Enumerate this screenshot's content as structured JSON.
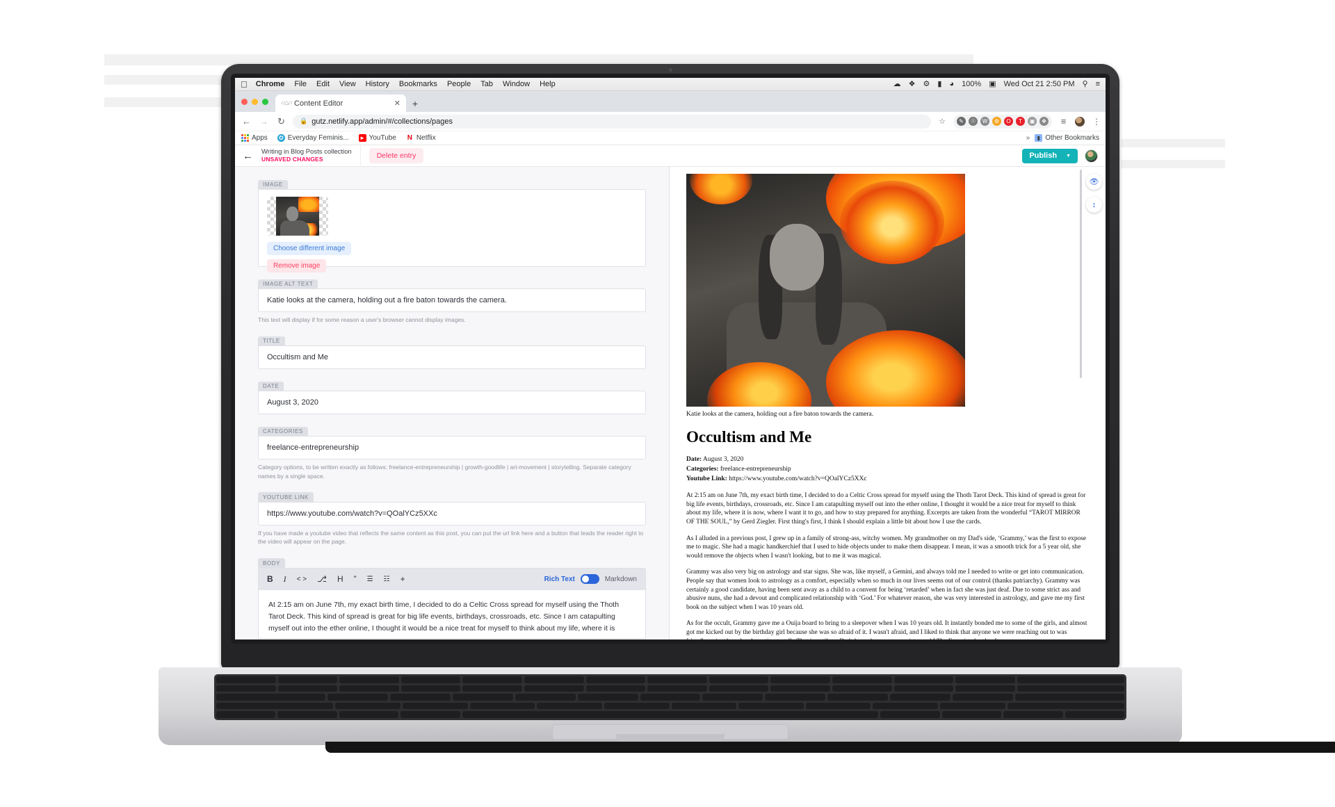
{
  "macos_menubar": {
    "apple_icon": "apple-logo",
    "items": [
      "Chrome",
      "File",
      "Edit",
      "View",
      "History",
      "Bookmarks",
      "People",
      "Tab",
      "Window",
      "Help"
    ],
    "status_icons": [
      "cloud-icon",
      "dropbox-icon",
      "vpn-icon",
      "battery-icon",
      "wifi-icon"
    ],
    "battery_percent": "100%",
    "clock": "Wed Oct 21  2:50 PM",
    "search_icon": "search-icon",
    "control_center_icon": "list-icon"
  },
  "browser": {
    "tab": {
      "title": "Content Editor",
      "favicon": "netlify-cms-favicon",
      "close_icon": "close-icon"
    },
    "new_tab_icon": "plus-icon",
    "nav": {
      "back_icon": "back-arrow-icon",
      "forward_icon": "forward-arrow-icon",
      "reload_icon": "reload-icon"
    },
    "omnibox": {
      "lock_icon": "lock-icon",
      "url": "gutz.netlify.app/admin/#/collections/pages"
    },
    "star_icon": "bookmark-star-icon",
    "extensions": [
      "eyedropper-icon",
      "shield-icon",
      "wordpress-icon",
      "gear-icon",
      "opera-icon",
      "toolbar-icon",
      "grammarly-icon",
      "puzzle-icon"
    ],
    "reading_list_icon": "reading-list-icon",
    "profile_icon": "profile-avatar",
    "menu_icon": "kebab-menu-icon",
    "bookmarks": [
      {
        "label": "Apps",
        "icon": "apps-grid-icon"
      },
      {
        "label": "Everyday Feminis...",
        "icon": "everyday-feminism-icon"
      },
      {
        "label": "YouTube",
        "icon": "youtube-icon"
      },
      {
        "label": "Netflix",
        "icon": "netflix-icon"
      }
    ],
    "bookmarks_overflow": "»",
    "other_bookmarks": "Other Bookmarks",
    "other_bookmarks_icon": "folder-icon"
  },
  "cms_header": {
    "back_icon": "back-arrow-icon",
    "collection_text": "Writing in Blog Posts collection",
    "status_text": "UNSAVED CHANGES",
    "delete_label": "Delete entry",
    "publish_label": "Publish",
    "publish_caret": "▼",
    "avatar": "user-avatar",
    "accent_publish": "#13b3b8",
    "accent_unsaved": "#ff0a5f",
    "accent_delete": "#ff3366"
  },
  "editor": {
    "image": {
      "label": "IMAGE",
      "choose_label": "Choose different image",
      "remove_label": "Remove image"
    },
    "alt": {
      "label": "IMAGE ALT TEXT",
      "value": "Katie looks at the camera, holding out a fire baton towards the camera.",
      "hint": "This text will display if for some reason a user's browser cannot display images."
    },
    "title": {
      "label": "TITLE",
      "value": "Occultism and Me"
    },
    "date": {
      "label": "DATE",
      "value": "August 3, 2020"
    },
    "categories": {
      "label": "CATEGORIES",
      "value": "freelance-entrepreneurship",
      "hint": "Category options, to be written exactly as follows: freelance-entrepreneurship | growth-goodlife | art-movement | storytelling. Separate category names by a single space."
    },
    "youtube": {
      "label": "YOUTUBE LINK",
      "value": "https://www.youtube.com/watch?v=QOalYCz5XXc",
      "hint": "If you have made a youtube video that reflects the same content as this post, you can put the url link here and a button that leads the reader right to the video will appear on the page."
    },
    "body": {
      "label": "BODY",
      "toolbar_icons": [
        "bold-icon",
        "italic-icon",
        "code-icon",
        "link-icon",
        "heading-icon",
        "quote-icon",
        "bullet-list-icon",
        "numbered-list-icon",
        "add-component-icon"
      ],
      "toolbar_glyphs": [
        "B",
        "I",
        "< >",
        "⎇",
        "H",
        "”",
        "☰",
        "☷",
        "+"
      ],
      "rich_text_label": "Rich Text",
      "markdown_label": "Markdown",
      "mode": "Markdown",
      "text": "At 2:15 am on June 7th, my exact birth time, I decided to do a Celtic Cross spread for myself using the Thoth Tarot Deck. This kind of spread is great for big life events, birthdays, crossroads, etc. Since I am catapulting myself out into the ether online, I thought it would be a nice treat for myself to think about my life, where it is"
    }
  },
  "preview": {
    "caption": "Katie looks at the camera, holding out a fire baton towards the camera.",
    "heading": "Occultism and Me",
    "meta": [
      {
        "key": "Date:",
        "value": " August 3, 2020"
      },
      {
        "key": "Categories:",
        "value": " freelance-entrepreneurship"
      },
      {
        "key": "Youtube Link:",
        "value": " https://www.youtube.com/watch?v=QOalYCz5XXc"
      }
    ],
    "paragraphs": [
      "At 2:15 am on June 7th, my exact birth time, I decided to do a Celtic Cross spread for myself using the Thoth Tarot Deck. This kind of spread is great for big life events, birthdays, crossroads, etc. Since I am catapulting myself out into the ether online, I thought it would be a nice treat for myself to think about my life, where it is now, where I want it to go, and how to stay prepared for anything. Excerpts are taken from the wonderful “TAROT MIRROR OF THE SOUL,” by Gerd Ziegler. First thing's first, I think I should explain a little bit about how I use the cards.",
      "As I alluded in a previous post, I grew up in a family of strong-ass, witchy women. My grandmother on my Dad's side, ‘Grammy,’ was the first to expose me to magic. She had a magic handkerchief that I used to hide objects under to make them disappear. I mean, it was a smooth trick for a 5 year old, she would remove the objects when I wasn't looking, but to me it was magical.",
      "Grammy was also very big on astrology and star signs. She was, like myself, a Gemini, and always told me I needed to write or get into communication. People say that women look to astrology as a comfort, especially when so much in our lives seems out of our control (thanks patriarchy). Grammy was certainly a good candidate, having been sent away as a child to a convent for being ‘retarded’ when in fact she was just deaf. Due to some strict ass and abusive nuns, she had a devout and complicated relationship with ‘God.’ For whatever reason, she was very interested in astrology, and gave me my first book on the subject when I was 10 years old.",
      "As for the occult, Grammy gave me a Ouija board to bring to a sleepover when I was 10 years old. It instantly bonded me to some of the girls, and almost got me kicked out by the birthday girl because she was so afraid of it. I wasn't afraid, and I liked to think that anyone we were reaching out to was friendly or just bored and wanting to talk. That is until my Dad showed my younger sister and I The Exorcist shortly after."
    ],
    "rail": {
      "preview_toggle_icon": "eye-icon",
      "scroll_sync_icon": "vertical-arrows-icon"
    }
  }
}
